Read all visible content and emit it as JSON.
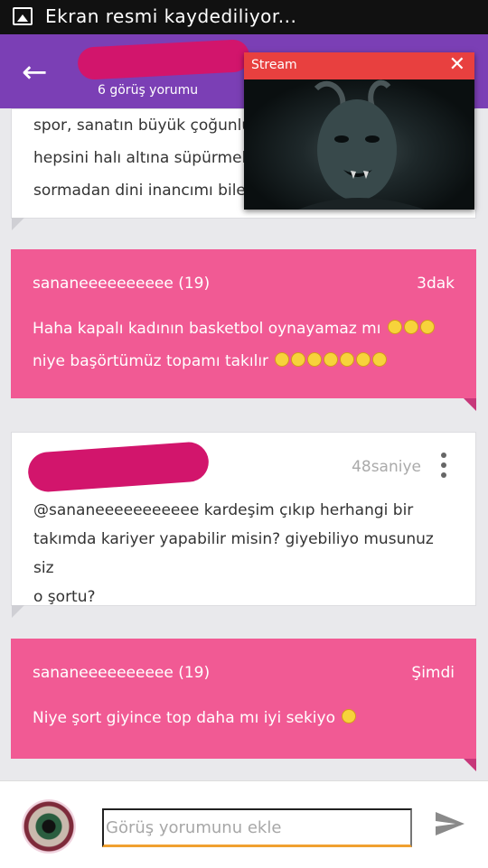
{
  "status_bar": {
    "text": "Ekran resmi kaydediliyor...",
    "icon": "image-icon"
  },
  "header": {
    "subtitle": "6 görüş yorumu",
    "back_icon": "arrow-back-icon",
    "accent": "#7b3fb5"
  },
  "stream_popup": {
    "title": "Stream",
    "close_icon": "close-icon"
  },
  "comments": [
    {
      "type": "white",
      "lines": [
        "spor, sanatın büyük çoğunlu",
        "hepsini halı altına süpürmek",
        "sormadan dini inancımı bilem"
      ]
    },
    {
      "type": "pink",
      "author": "sananeeeeeeeeee (19)",
      "time": "3dak",
      "lines": [
        "Haha kapalı kadının basketbol oynayamaz mı",
        "niye başörtümüz topamı takılır"
      ]
    },
    {
      "type": "white",
      "time": "48saniye",
      "lines": [
        "@sananeeeeeeeeeee kardeşim çıkıp herhangi bir",
        "takımda kariyer yapabilir misin? giyebiliyo musunuz siz",
        "o şortu?"
      ]
    },
    {
      "type": "pink",
      "author": "sananeeeeeeeeee (19)",
      "time": "Şimdi",
      "lines": [
        "Niye şort giyince top daha mı iyi sekiyo"
      ]
    }
  ],
  "composer": {
    "placeholder": "Görüş yorumunu ekle",
    "send_icon": "send-icon"
  },
  "colors": {
    "pink": "#f15a94",
    "redaction": "#d2156c",
    "stream_header": "#e8403f",
    "input_underline": "#f0a030"
  }
}
